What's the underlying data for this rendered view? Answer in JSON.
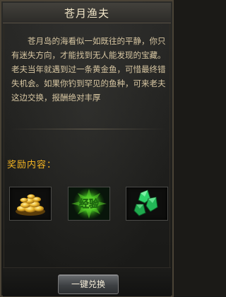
{
  "title": "苍月渔夫",
  "story": "苍月岛的海看似一如既往的平静，你只有迷失方向，才能找到无人能发现的宝藏。老夫当年就遇到过一条黄金鱼，可惜最终错失机会。如果你钓到罕见的鱼种，可来老夫这边交换，报酬绝对丰厚",
  "rewards": {
    "heading": "奖励内容：",
    "items": [
      {
        "icon": "gold-coins-icon"
      },
      {
        "icon": "experience-icon",
        "label": "经验"
      },
      {
        "icon": "green-gem-icon"
      }
    ]
  },
  "redeem_button": "一键兑换",
  "colors": {
    "title_text": "#f2e6c8",
    "story_text": "#d7c6a2",
    "heading_text": "#f3b422",
    "gem_green": "#2fd36a"
  }
}
